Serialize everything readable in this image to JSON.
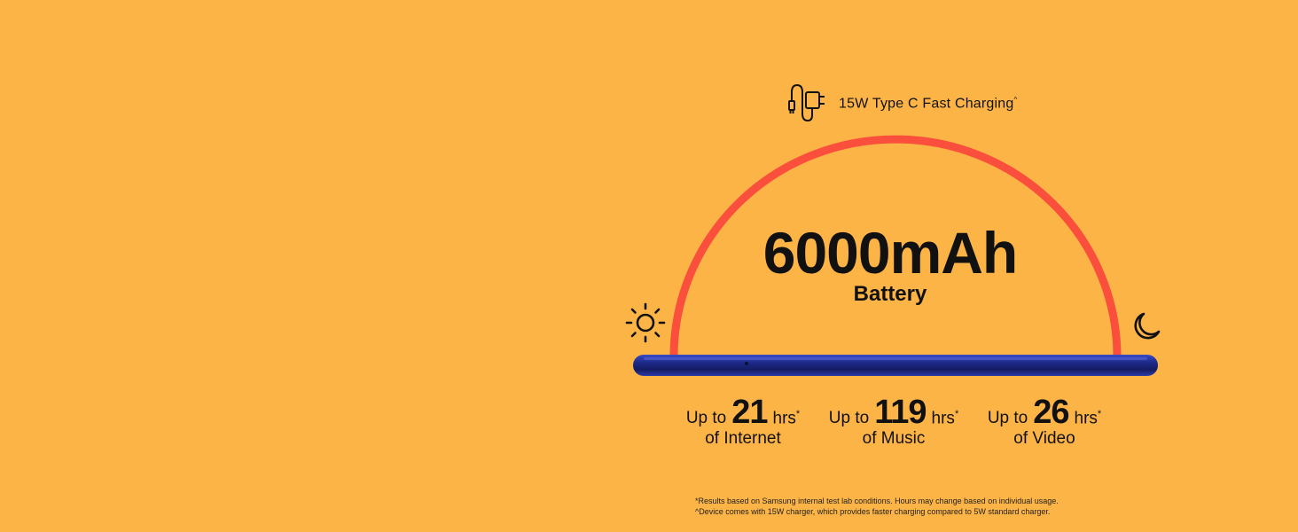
{
  "charging": {
    "icon": "charger-cable-icon",
    "label": "15W Type C Fast Charging",
    "mark": "^"
  },
  "battery": {
    "capacity": "6000mAh",
    "label": "Battery"
  },
  "icons": {
    "day": "sun-icon",
    "night": "moon-icon"
  },
  "colors": {
    "background": "#FDB446",
    "arc": "#F94F3C",
    "phone": "#1E2A8C",
    "text": "#111111"
  },
  "stats": [
    {
      "prefix": "Up to",
      "value": "21",
      "unit": "hrs",
      "mark": "*",
      "label": "of Internet"
    },
    {
      "prefix": "Up to",
      "value": "119",
      "unit": "hrs",
      "mark": "*",
      "label": "of Music"
    },
    {
      "prefix": "Up to",
      "value": "26",
      "unit": "hrs",
      "mark": "*",
      "label": "of Video"
    }
  ],
  "footnotes": [
    "*Results based on Samsung internal test lab conditions. Hours may change based on individual usage.",
    "^Device comes with 15W charger, which provides faster charging compared to 5W standard charger."
  ]
}
